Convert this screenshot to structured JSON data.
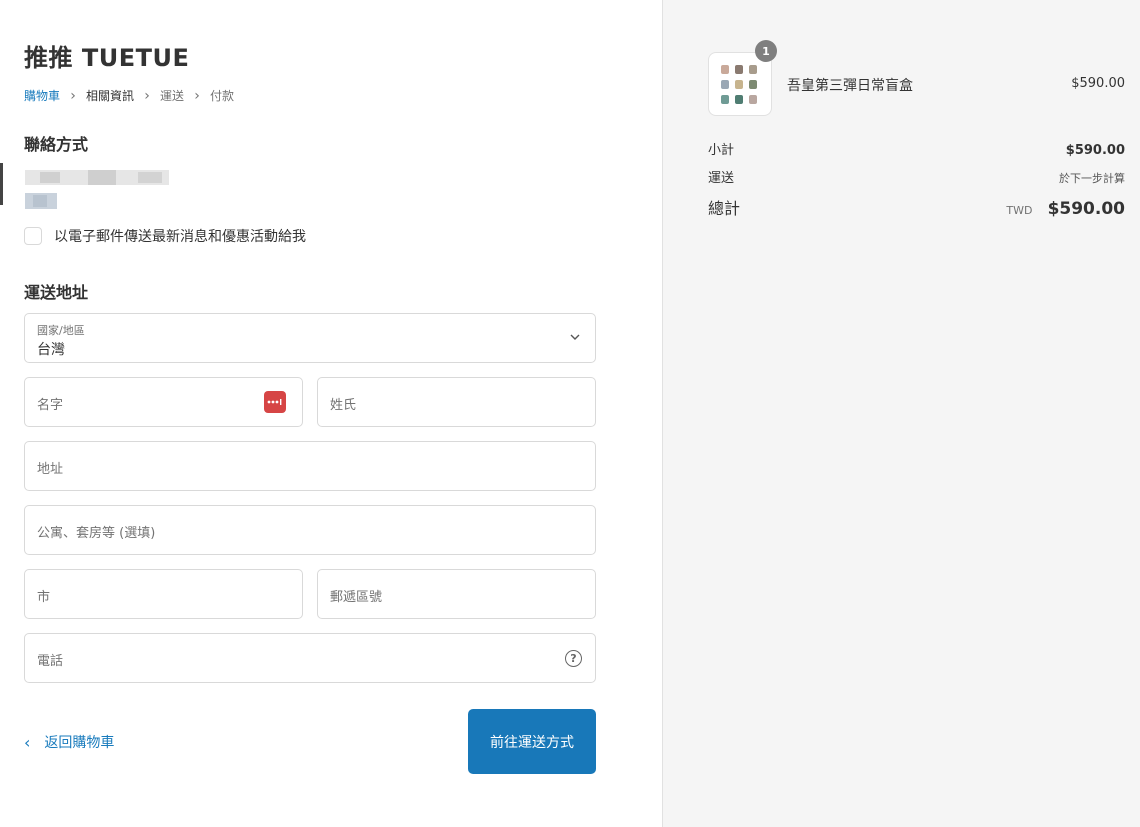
{
  "store": {
    "title": "推推 TUETUE"
  },
  "breadcrumb": [
    {
      "label": "購物車"
    },
    {
      "label": "相關資訊"
    },
    {
      "label": "運送"
    },
    {
      "label": "付款"
    }
  ],
  "contact": {
    "title": "聯絡方式",
    "newsletter_label": "以電子郵件傳送最新消息和優惠活動給我"
  },
  "shipping": {
    "title": "運送地址",
    "country_label": "國家/地區",
    "country_value": "台灣",
    "first_name_placeholder": "名字",
    "last_name_placeholder": "姓氏",
    "address_placeholder": "地址",
    "apartment_placeholder": "公寓、套房等 (選填)",
    "city_placeholder": "市",
    "postal_placeholder": "郵遞區號",
    "phone_placeholder": "電話",
    "help_glyph": "?"
  },
  "actions": {
    "back_label": "返回購物車",
    "continue_label": "前往運送方式"
  },
  "summary": {
    "product": {
      "name": "吾皇第三彈日常盲盒",
      "price": "$590.00",
      "quantity": "1"
    },
    "subtotal_label": "小計",
    "subtotal_value": "$590.00",
    "shipping_label": "運送",
    "shipping_value": "於下一步計算",
    "total_label": "總計",
    "total_currency": "TWD",
    "total_value": "$590.00"
  },
  "colors": {
    "accent": "#1878b9",
    "link": "#197bbd",
    "sidebar_bg": "#f5f5f5",
    "password_badge": "#d64545"
  },
  "icons": [
    "chevron-right-icon",
    "chevron-down-icon",
    "password-manager-icon",
    "help-icon",
    "chevron-left-icon"
  ]
}
